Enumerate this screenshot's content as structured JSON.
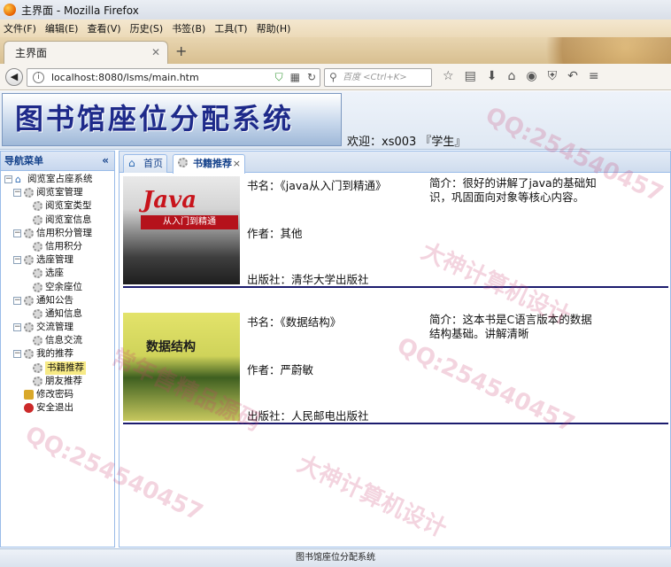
{
  "window": {
    "title": "主界面 - Mozilla Firefox"
  },
  "browser": {
    "menu": [
      "文件(F)",
      "编辑(E)",
      "查看(V)",
      "历史(S)",
      "书签(B)",
      "工具(T)",
      "帮助(H)"
    ],
    "tab_title": "主界面",
    "url": "localhost:8080/lsms/main.htm",
    "search_placeholder": "百度 <Ctrl+K>"
  },
  "app": {
    "banner": "图书馆座位分配系统",
    "welcome": "欢迎：xs003 『学生』"
  },
  "sidebar": {
    "header": "导航菜单",
    "tree": [
      {
        "label": "阅览室占座系统",
        "level": 0,
        "toggle": "−",
        "icon": "home-icon"
      },
      {
        "label": "阅览室管理",
        "level": 1,
        "toggle": "−",
        "icon": "gear-icon"
      },
      {
        "label": "阅览室类型",
        "level": 2,
        "icon": "gear-icon"
      },
      {
        "label": "阅览室信息",
        "level": 2,
        "icon": "gear-icon"
      },
      {
        "label": "信用积分管理",
        "level": 1,
        "toggle": "−",
        "icon": "gear-icon"
      },
      {
        "label": "信用积分",
        "level": 2,
        "icon": "gear-icon"
      },
      {
        "label": "选座管理",
        "level": 1,
        "toggle": "−",
        "icon": "gear-icon"
      },
      {
        "label": "选座",
        "level": 2,
        "icon": "gear-icon"
      },
      {
        "label": "空余座位",
        "level": 2,
        "icon": "gear-icon"
      },
      {
        "label": "通知公告",
        "level": 1,
        "toggle": "−",
        "icon": "gear-icon"
      },
      {
        "label": "通知信息",
        "level": 2,
        "icon": "gear-icon"
      },
      {
        "label": "交流管理",
        "level": 1,
        "toggle": "−",
        "icon": "gear-icon"
      },
      {
        "label": "信息交流",
        "level": 2,
        "icon": "gear-icon"
      },
      {
        "label": "我的推荐",
        "level": 1,
        "toggle": "−",
        "icon": "gear-icon"
      },
      {
        "label": "书籍推荐",
        "level": 2,
        "icon": "gear-icon",
        "selected": true
      },
      {
        "label": "朋友推荐",
        "level": 2,
        "icon": "gear-icon"
      },
      {
        "label": "修改密码",
        "level": 1,
        "icon": "lock-icon"
      },
      {
        "label": "安全退出",
        "level": 1,
        "icon": "power-icon"
      }
    ]
  },
  "content": {
    "tabs": [
      {
        "label": "首页",
        "icon": "home-icon"
      },
      {
        "label": "书籍推荐",
        "icon": "gear-icon",
        "active": true,
        "closable": true
      }
    ],
    "books": [
      {
        "cover_title": "Java",
        "cover_subtitle": "从入门到精通",
        "name": "书名：《java从入门到精通》",
        "author": "作者：其他",
        "publisher": "出版社：清华大学出版社",
        "intro": "简介：很好的讲解了java的基础知识，巩固面向对象等核心内容。"
      },
      {
        "cover_title": "数据结构",
        "name": "书名：《数据结构》",
        "author": "作者：严蔚敏",
        "publisher": "出版社：人民邮电出版社",
        "intro": "简介：这本书是C语言版本的数据结构基础。讲解清晰"
      }
    ]
  },
  "footer": {
    "text": "图书馆座位分配系统"
  },
  "watermark": [
    "QQ:254540457",
    "大神计算机设计",
    "常年售精品源码"
  ]
}
